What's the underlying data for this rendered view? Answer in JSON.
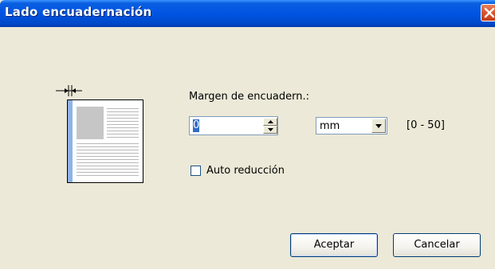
{
  "window": {
    "title": "Lado encuadernación"
  },
  "margin": {
    "label": "Margen de encuadern.:",
    "value": "0",
    "unit": "mm",
    "range": "[0 - 50]"
  },
  "auto_reduce": {
    "label": "Auto reducción",
    "checked": false
  },
  "buttons": {
    "ok": "Aceptar",
    "cancel": "Cancelar"
  },
  "icons": {
    "close": "close-icon",
    "preview": "binding-margin-preview-icon",
    "spin_up": "arrow-up-icon",
    "spin_down": "arrow-down-icon",
    "dropdown": "chevron-down-icon"
  },
  "colors": {
    "title_bar": "#0054e3",
    "dialog_bg": "#ece9d8",
    "binding_strip": "#8fb3e8",
    "close_button": "#d8542d",
    "selection": "#316ac5"
  }
}
